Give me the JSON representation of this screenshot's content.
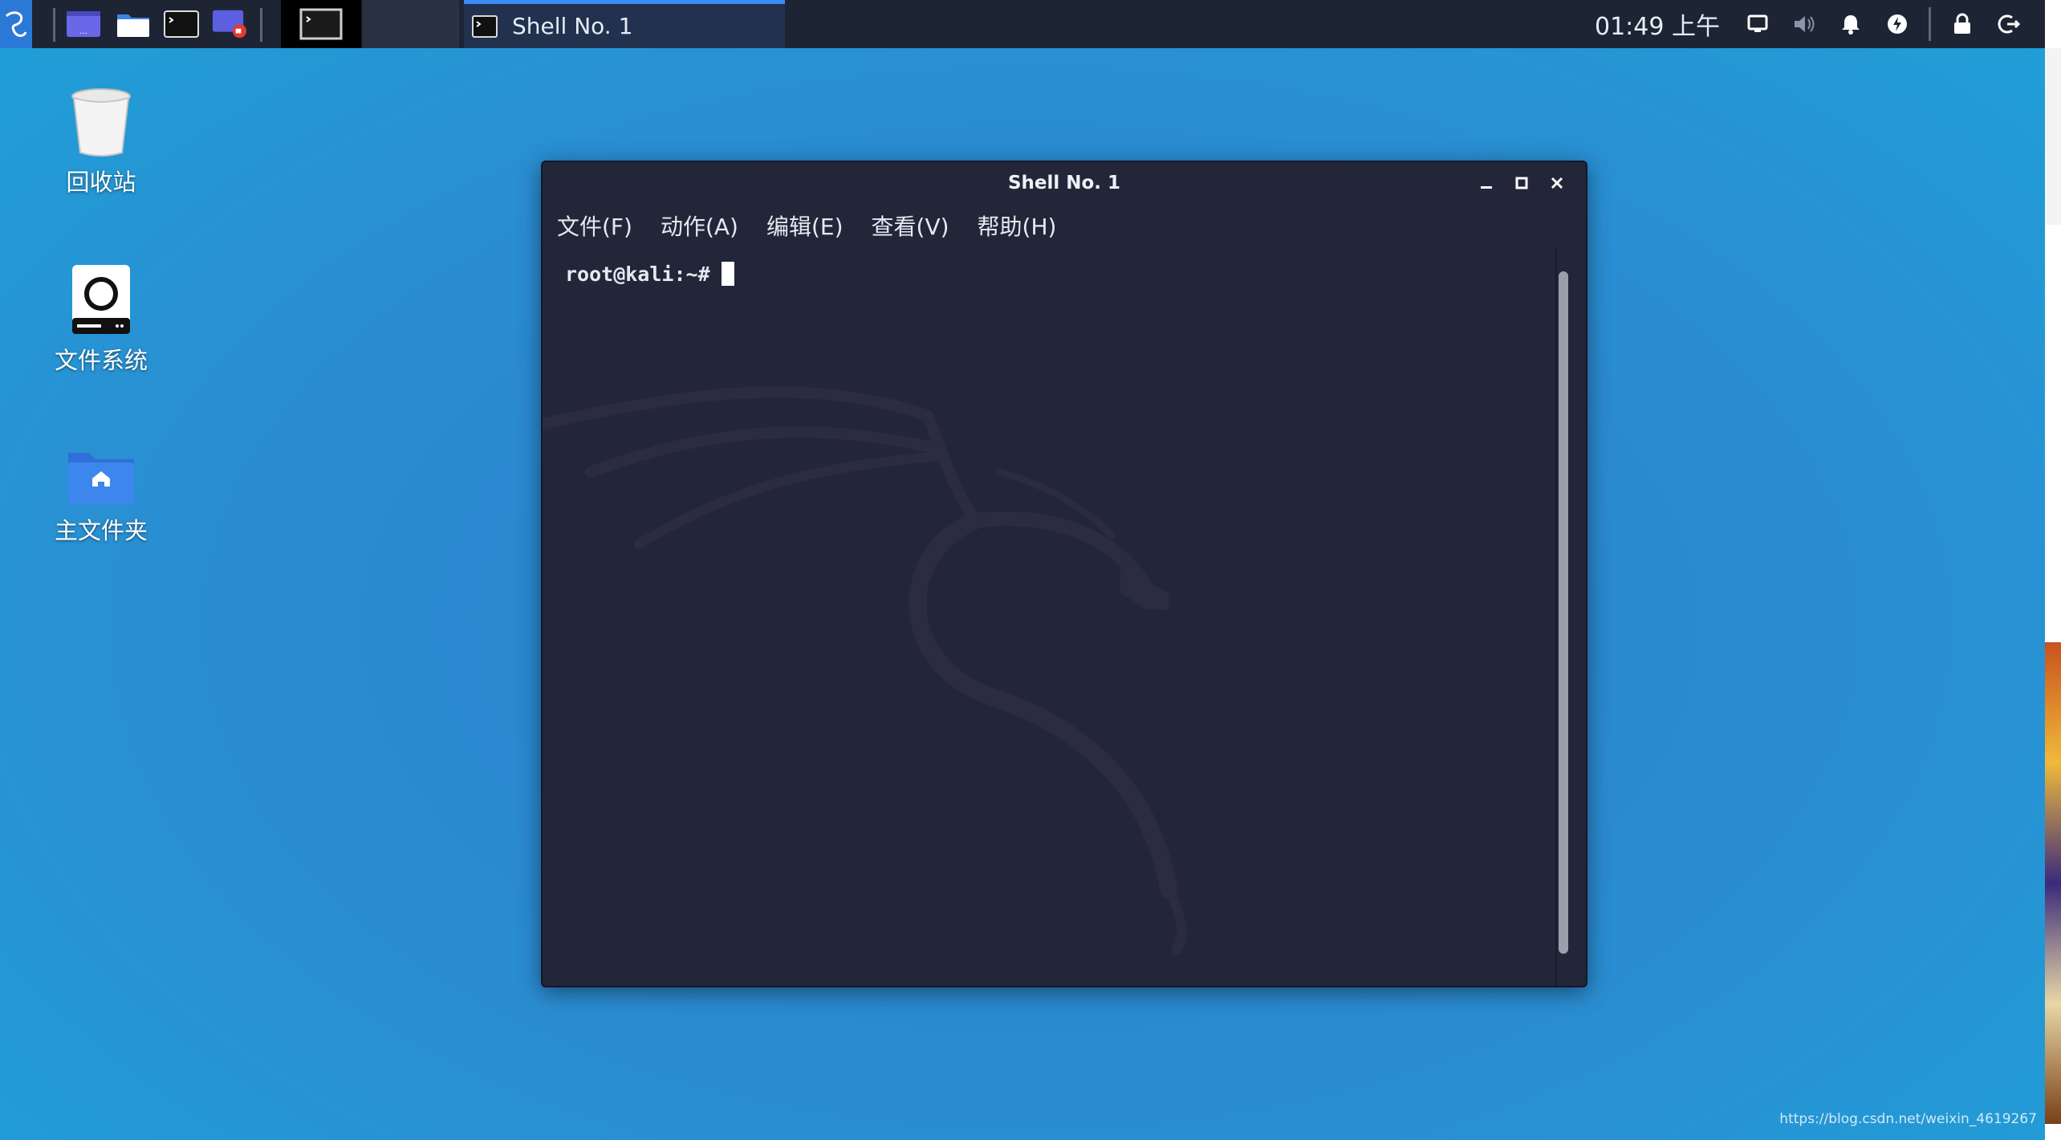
{
  "panel": {
    "task_window_title": "Shell No. 1",
    "clock": "01:49 上午",
    "tray_icons": [
      "display-icon",
      "volume-icon",
      "bell-icon",
      "power-icon",
      "lock-icon",
      "logout-icon"
    ],
    "launchers": [
      "workspace-icon",
      "file-manager-icon",
      "terminal-icon",
      "screen-recorder-icon"
    ],
    "accent_color": "#3b8cf5"
  },
  "desktop": {
    "icons": [
      {
        "label": "回收站",
        "icon": "trash-icon"
      },
      {
        "label": "文件系统",
        "icon": "drive-icon"
      },
      {
        "label": "主文件夹",
        "icon": "home-folder-icon"
      }
    ]
  },
  "terminal": {
    "title": "Shell No. 1",
    "menu": [
      "文件(F)",
      "动作(A)",
      "编辑(E)",
      "查看(V)",
      "帮助(H)"
    ],
    "prompt": "root@kali:~#",
    "background_color": "#232639"
  },
  "watermark": "https://blog.csdn.net/weixin_4619267"
}
